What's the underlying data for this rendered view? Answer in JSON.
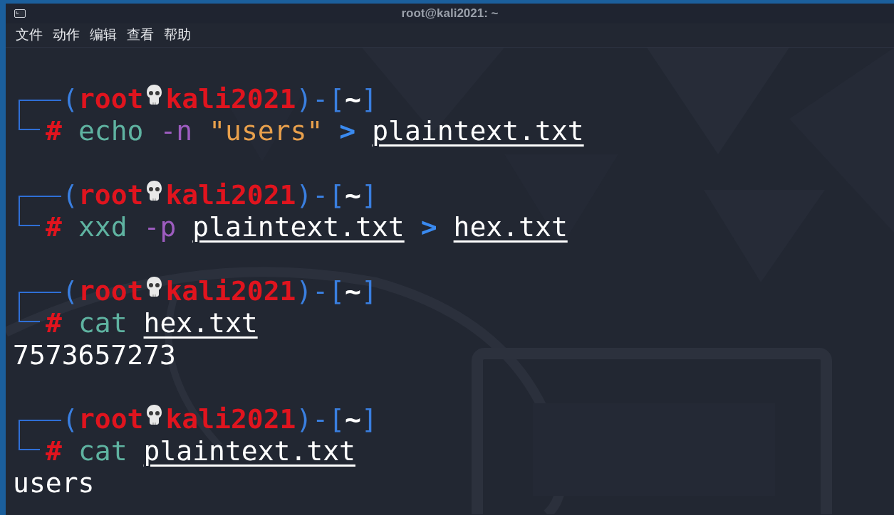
{
  "window": {
    "title": "root@kali2021: ~"
  },
  "menu": [
    "文件",
    "动作",
    "编辑",
    "查看",
    "帮助"
  ],
  "terminal": {
    "blocks": [
      {
        "prompt": [
          {
            "kind": "paren",
            "text": "("
          },
          {
            "kind": "user",
            "text": "root"
          },
          {
            "kind": "skull"
          },
          {
            "kind": "user",
            "text": "kali2021"
          },
          {
            "kind": "paren",
            "text": ")"
          },
          {
            "kind": "dash",
            "text": "-"
          },
          {
            "kind": "paren",
            "text": "["
          },
          {
            "kind": "dir",
            "text": "~"
          },
          {
            "kind": "paren",
            "text": "]"
          }
        ],
        "command": [
          {
            "kind": "hash",
            "text": "#"
          },
          {
            "kind": "cmd",
            "text": "echo"
          },
          {
            "kind": "flag",
            "text": "-n"
          },
          {
            "kind": "string",
            "text": "\"users\""
          },
          {
            "kind": "op",
            "text": ">"
          },
          {
            "kind": "path",
            "text": "plaintext.txt"
          }
        ]
      },
      {
        "prompt": [
          {
            "kind": "paren",
            "text": "("
          },
          {
            "kind": "user",
            "text": "root"
          },
          {
            "kind": "skull"
          },
          {
            "kind": "user",
            "text": "kali2021"
          },
          {
            "kind": "paren",
            "text": ")"
          },
          {
            "kind": "dash",
            "text": "-"
          },
          {
            "kind": "paren",
            "text": "["
          },
          {
            "kind": "dir",
            "text": "~"
          },
          {
            "kind": "paren",
            "text": "]"
          }
        ],
        "command": [
          {
            "kind": "hash",
            "text": "#"
          },
          {
            "kind": "cmd",
            "text": "xxd"
          },
          {
            "kind": "flag",
            "text": "-p"
          },
          {
            "kind": "path",
            "text": "plaintext.txt"
          },
          {
            "kind": "op",
            "text": ">"
          },
          {
            "kind": "path",
            "text": "hex.txt"
          }
        ]
      },
      {
        "prompt": [
          {
            "kind": "paren",
            "text": "("
          },
          {
            "kind": "user",
            "text": "root"
          },
          {
            "kind": "skull"
          },
          {
            "kind": "user",
            "text": "kali2021"
          },
          {
            "kind": "paren",
            "text": ")"
          },
          {
            "kind": "dash",
            "text": "-"
          },
          {
            "kind": "paren",
            "text": "["
          },
          {
            "kind": "dir",
            "text": "~"
          },
          {
            "kind": "paren",
            "text": "]"
          }
        ],
        "command": [
          {
            "kind": "hash",
            "text": "#"
          },
          {
            "kind": "cmd",
            "text": "cat"
          },
          {
            "kind": "path",
            "text": "hex.txt"
          }
        ],
        "output": [
          "7573657273"
        ]
      },
      {
        "prompt": [
          {
            "kind": "paren",
            "text": "("
          },
          {
            "kind": "user",
            "text": "root"
          },
          {
            "kind": "skull"
          },
          {
            "kind": "user",
            "text": "kali2021"
          },
          {
            "kind": "paren",
            "text": ")"
          },
          {
            "kind": "dash",
            "text": "-"
          },
          {
            "kind": "paren",
            "text": "["
          },
          {
            "kind": "dir",
            "text": "~"
          },
          {
            "kind": "paren",
            "text": "]"
          }
        ],
        "command": [
          {
            "kind": "hash",
            "text": "#"
          },
          {
            "kind": "cmd",
            "text": "cat"
          },
          {
            "kind": "path",
            "text": "plaintext.txt"
          }
        ],
        "output": [
          "users"
        ]
      }
    ]
  }
}
